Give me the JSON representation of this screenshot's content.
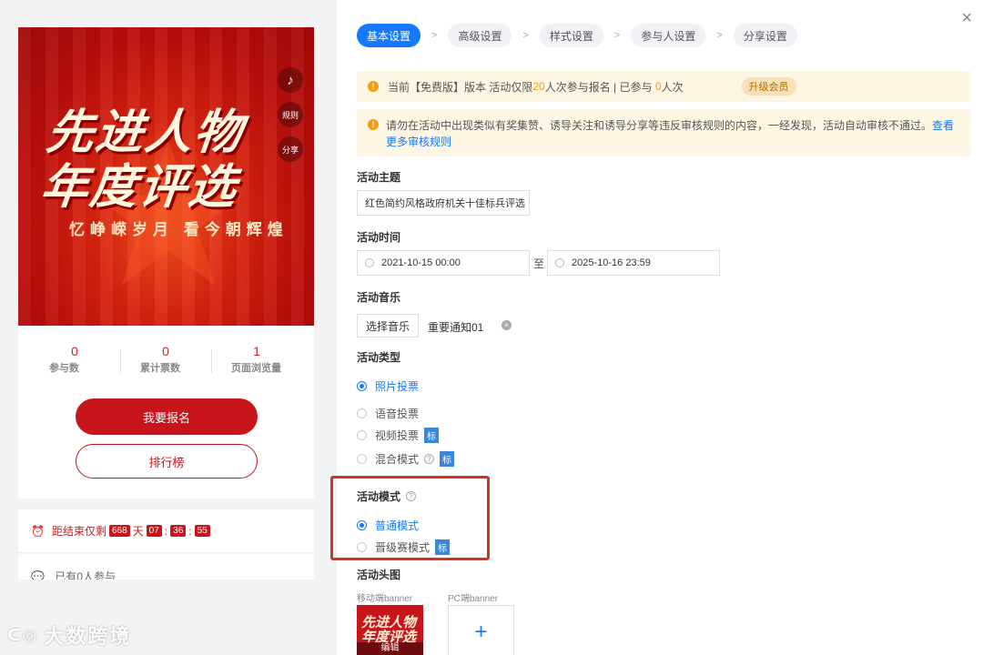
{
  "preview": {
    "poster_title_line1": "先进人物",
    "poster_title_line2": "年度评选",
    "poster_subtitle": "忆峥嵘岁月 看今朝辉煌",
    "side_music_icon": "music-note-icon",
    "side_rule": "规则",
    "side_share": "分享",
    "stats": [
      {
        "value": "0",
        "label": "参与数"
      },
      {
        "value": "0",
        "label": "累计票数"
      },
      {
        "value": "1",
        "label": "页面浏览量"
      }
    ],
    "signup_button": "我要报名",
    "rank_button": "排行榜",
    "countdown": {
      "prefix": "距结束仅剩",
      "days": "668",
      "day_unit": "天",
      "hours": "07",
      "minutes": "36",
      "seconds": "55",
      "sep": ":"
    },
    "participants_text": "已有0人参与"
  },
  "watermark": "大数跨境",
  "steps": [
    "基本设置",
    "高级设置",
    "样式设置",
    "参与人设置",
    "分享设置"
  ],
  "step_separator": ">",
  "notice1": {
    "pre": "当前【免费版】版本 活动仅限",
    "limit": "20",
    "mid": "人次参与报名 | 已参与 ",
    "count": "0",
    "post": "人次",
    "upgrade": "升级会员"
  },
  "notice2": {
    "text": "请勿在活动中出现类似有奖集赞、诱导关注和诱导分享等违反审核规则的内容，一经发现，活动自动审核不通过。",
    "link": "查看更多审核规则"
  },
  "form": {
    "theme_label": "活动主题",
    "theme_value": "红色简约风格政府机关十佳标兵评选",
    "time_label": "活动时间",
    "start_time": "2021-10-15 00:00",
    "to": "至",
    "end_time": "2025-10-16 23:59",
    "music_label": "活动音乐",
    "music_button": "选择音乐",
    "music_name": "重要通知01",
    "type_label": "活动类型",
    "types": [
      "照片投票",
      "语音投票",
      "视频投票",
      "混合模式"
    ],
    "badge": "标",
    "mode_label": "活动模式",
    "modes": [
      "普通模式",
      "晋级赛模式"
    ],
    "banner_label": "活动头图",
    "mobile_banner": "移动端banner",
    "pc_banner": "PC端banner",
    "banner_edit": "编辑",
    "add_symbol": "+"
  },
  "colors": {
    "accent": "#1677ff",
    "brand_red": "#c8141b",
    "warning": "#f29d13",
    "highlight_border": "#d93025"
  }
}
